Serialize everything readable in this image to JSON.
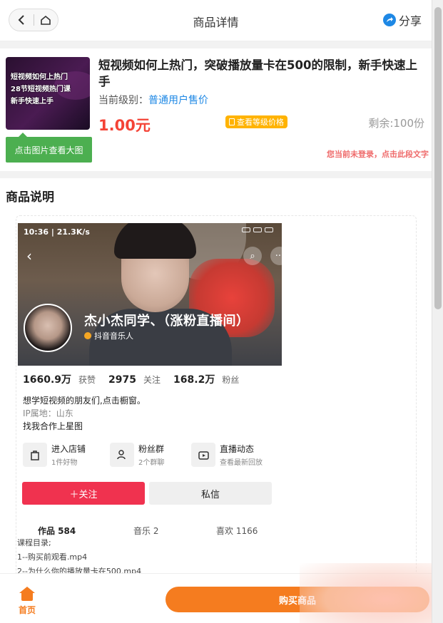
{
  "header": {
    "title": "商品详情",
    "share_label": "分享"
  },
  "product": {
    "thumb_text": [
      "短视频如何上热门",
      "28节短视频热门课",
      "新手快速上手"
    ],
    "view_image_label": "点击图片查看大图",
    "title": "短视频如何上热门，突破播放量卡在500的限制，新手快速上手",
    "level_label": "当前级别：",
    "level_value": "普通用户售价",
    "price": "1.00元",
    "level_price_button": "查看等级价格",
    "remaining": "剩余:100份",
    "login_notice": "您当前未登录，点击此段文字"
  },
  "description": {
    "section_title": "商品说明",
    "screenshot": {
      "status_time": "10:36 | 21.3K/s",
      "username": "杰小杰同学、（涨粉直播间）",
      "user_tag": "抖音音乐人"
    },
    "stats": [
      {
        "value": "1660.9万",
        "label": "获赞"
      },
      {
        "value": "2975",
        "label": "关注"
      },
      {
        "value": "168.2万",
        "label": "粉丝"
      }
    ],
    "bio": [
      "想学短视频的朋友们,点击橱窗。",
      "IP属地：山东",
      "找我合作上星图"
    ],
    "actions": [
      {
        "title": "进入店铺",
        "sub": "1件好物",
        "icon": "shop-bag-icon"
      },
      {
        "title": "粉丝群",
        "sub": "2个群聊",
        "icon": "fan-group-icon"
      },
      {
        "title": "直播动态",
        "sub": "查看最新回放",
        "icon": "live-tv-icon"
      }
    ],
    "follow_label": "＋关注",
    "message_label": "私信",
    "tabs": {
      "works": "作品 584",
      "music": "音乐 2",
      "likes": "喜欢 1166"
    },
    "catalog": [
      "课程目录;",
      "1--购买前观看.mp4",
      "2--为什么你的播放量卡在500.mp4"
    ]
  },
  "footer": {
    "home_label": "首页",
    "buy_label": "购买商品"
  },
  "colors": {
    "accent": "#f57c1f",
    "price": "#f44336",
    "link": "#1e88e5",
    "green": "#4caf50",
    "follow": "#f0324f"
  }
}
